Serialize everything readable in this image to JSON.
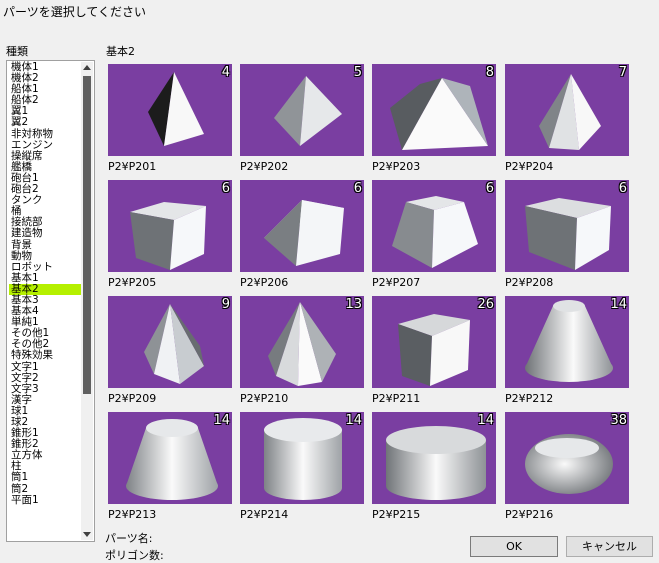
{
  "window": {
    "title": "パーツを選択してください"
  },
  "category_label": "種類",
  "categories": [
    "機体1",
    "機体2",
    "船体1",
    "船体2",
    "翼1",
    "翼2",
    "非対称物",
    "エンジン",
    "操縦席",
    "艦橋",
    "砲台1",
    "砲台2",
    "タンク",
    "桶",
    "接続部",
    "建造物",
    "背景",
    "動物",
    "ロボット",
    "基本1",
    "基本2",
    "基本3",
    "基本4",
    "単純1",
    "その他1",
    "その他2",
    "特殊効果",
    "文字1",
    "文字2",
    "文字3",
    "漢字",
    "球1",
    "球2",
    "錐形1",
    "錐形2",
    "立方体",
    "柱",
    "筒1",
    "筒2",
    "平面1"
  ],
  "selected_category": "基本2",
  "group_label": "基本2",
  "parts": [
    {
      "name": "P2¥P201",
      "polygons": "4",
      "shape": "tetra"
    },
    {
      "name": "P2¥P202",
      "polygons": "5",
      "shape": "pyr4"
    },
    {
      "name": "P2¥P203",
      "polygons": "8",
      "shape": "flatpyr"
    },
    {
      "name": "P2¥P204",
      "polygons": "7",
      "shape": "pyr5"
    },
    {
      "name": "P2¥P205",
      "polygons": "6",
      "shape": "cube"
    },
    {
      "name": "P2¥P206",
      "polygons": "6",
      "shape": "wedge"
    },
    {
      "name": "P2¥P207",
      "polygons": "6",
      "shape": "frustum4"
    },
    {
      "name": "P2¥P208",
      "polygons": "6",
      "shape": "slab"
    },
    {
      "name": "P2¥P209",
      "polygons": "9",
      "shape": "pyr8"
    },
    {
      "name": "P2¥P210",
      "polygons": "13",
      "shape": "cone"
    },
    {
      "name": "P2¥P211",
      "polygons": "26",
      "shape": "roundcube"
    },
    {
      "name": "P2¥P212",
      "polygons": "14",
      "shape": "coneT1"
    },
    {
      "name": "P2¥P213",
      "polygons": "14",
      "shape": "coneT2"
    },
    {
      "name": "P2¥P214",
      "polygons": "14",
      "shape": "cyl"
    },
    {
      "name": "P2¥P215",
      "polygons": "14",
      "shape": "widecyl"
    },
    {
      "name": "P2¥P216",
      "polygons": "38",
      "shape": "barrel"
    }
  ],
  "info": {
    "part_name_label": "パーツ名:",
    "polygon_count_label": "ポリゴン数:"
  },
  "buttons": {
    "ok": "OK",
    "cancel": "キャンセル"
  },
  "colors": {
    "thumb_bg": "#7a3ea1",
    "selected_bg": "#b5f000"
  }
}
